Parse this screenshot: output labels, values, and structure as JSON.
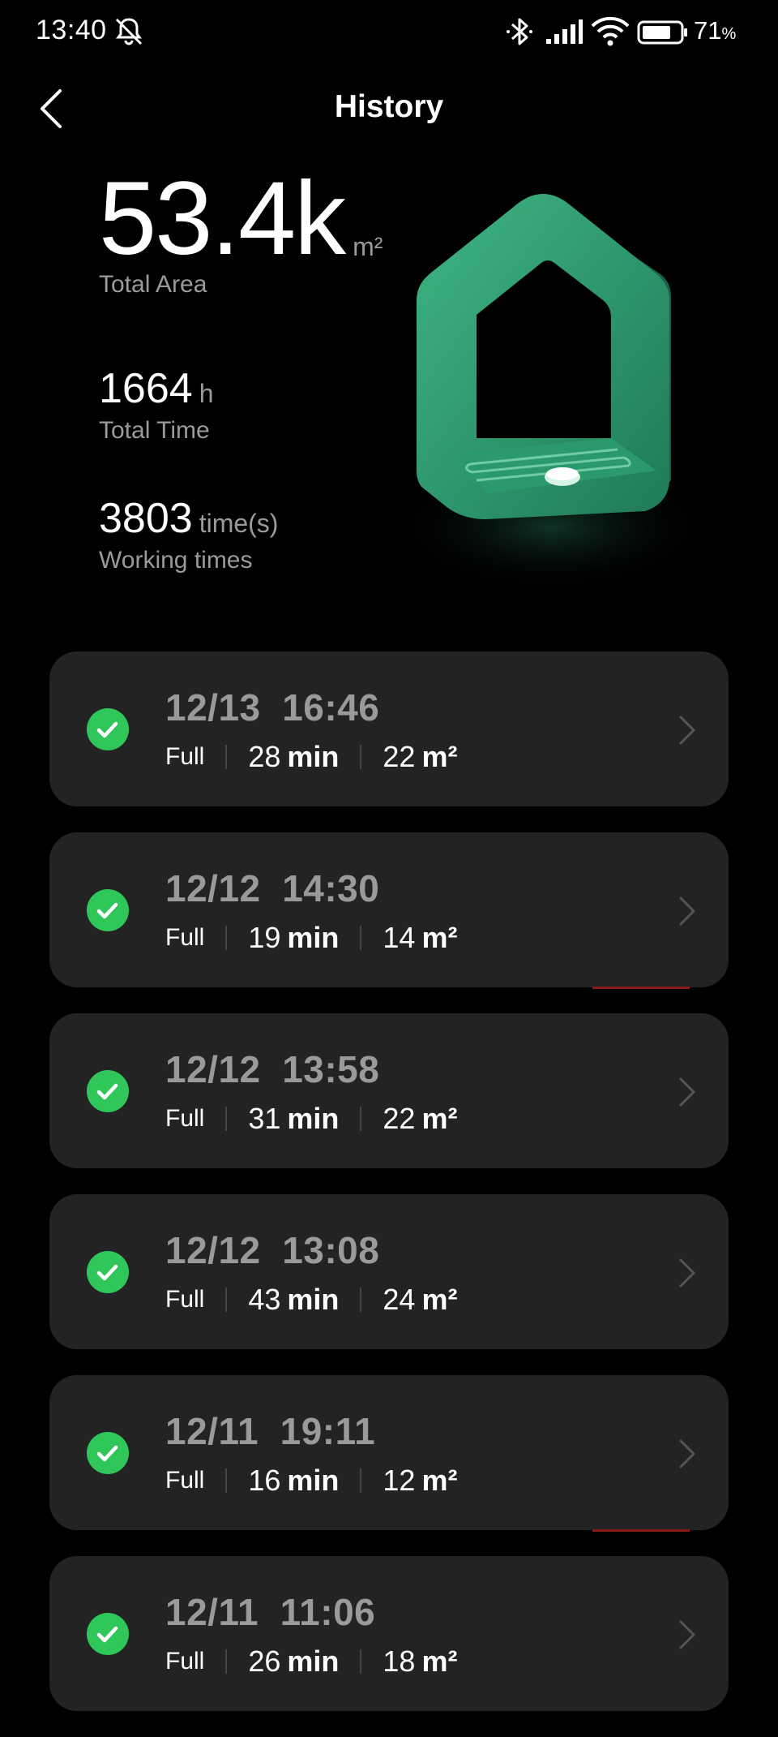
{
  "status_bar": {
    "time": "13:40",
    "battery_level": "71",
    "battery_unit": "%",
    "icons": [
      "mute-icon",
      "bluetooth-icon",
      "signal-icon",
      "wifi-icon",
      "battery-icon"
    ]
  },
  "header": {
    "title": "History",
    "back_icon": "back-icon"
  },
  "stats": {
    "total_area": {
      "value": "53.4k",
      "unit": "m²",
      "label": "Total Area"
    },
    "total_time": {
      "value": "1664",
      "unit": "h",
      "label": "Total Time"
    },
    "working_times": {
      "value": "3803",
      "unit": "time(s)",
      "label": "Working times"
    }
  },
  "colors": {
    "background": "#000000",
    "card": "#232323",
    "success_green": "#2fc75a",
    "muted_text": "#9a9a9a",
    "house_green": "#2f9e6f"
  },
  "history": [
    {
      "date": "12/13",
      "time": "16:46",
      "mode": "Full",
      "duration": "28",
      "duration_unit": "min",
      "area": "22",
      "area_unit": "m²",
      "status_icon": "check-circle-icon"
    },
    {
      "date": "12/12",
      "time": "14:30",
      "mode": "Full",
      "duration": "19",
      "duration_unit": "min",
      "area": "14",
      "area_unit": "m²",
      "status_icon": "check-circle-icon"
    },
    {
      "date": "12/12",
      "time": "13:58",
      "mode": "Full",
      "duration": "31",
      "duration_unit": "min",
      "area": "22",
      "area_unit": "m²",
      "status_icon": "check-circle-icon"
    },
    {
      "date": "12/12",
      "time": "13:08",
      "mode": "Full",
      "duration": "43",
      "duration_unit": "min",
      "area": "24",
      "area_unit": "m²",
      "status_icon": "check-circle-icon"
    },
    {
      "date": "12/11",
      "time": "19:11",
      "mode": "Full",
      "duration": "16",
      "duration_unit": "min",
      "area": "12",
      "area_unit": "m²",
      "status_icon": "check-circle-icon"
    },
    {
      "date": "12/11",
      "time": "11:06",
      "mode": "Full",
      "duration": "26",
      "duration_unit": "min",
      "area": "18",
      "area_unit": "m²",
      "status_icon": "check-circle-icon"
    }
  ]
}
